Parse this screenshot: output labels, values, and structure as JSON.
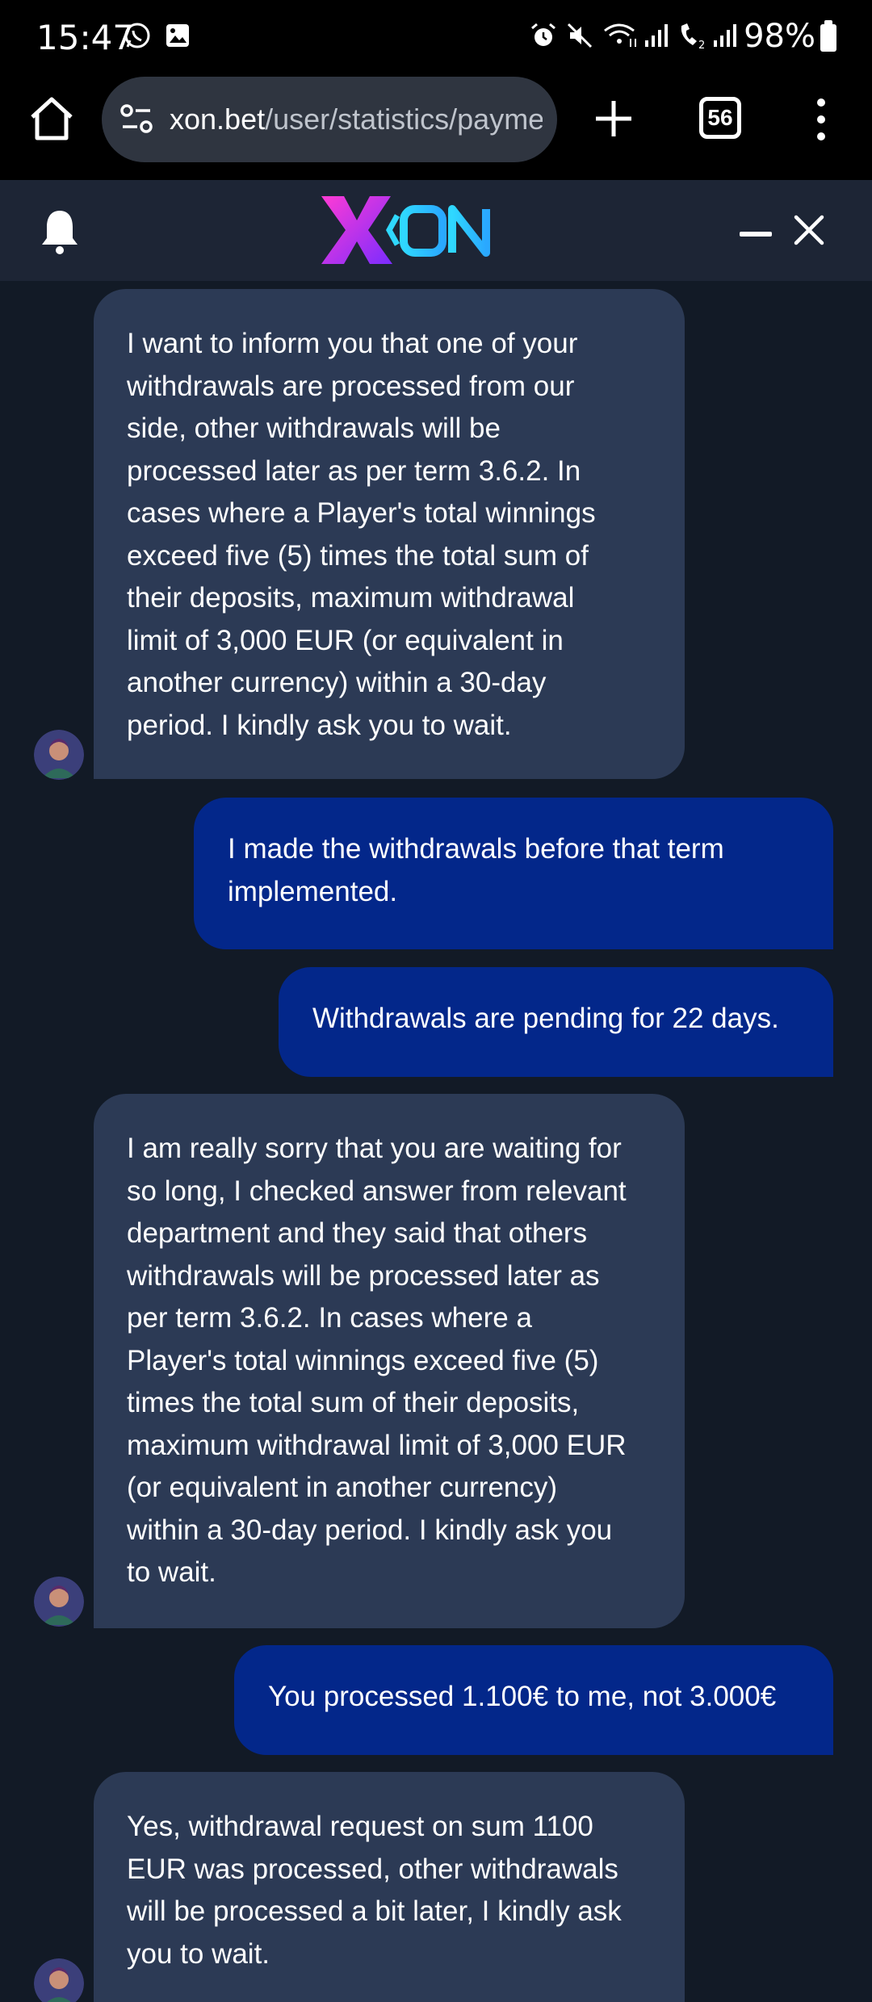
{
  "status_bar": {
    "time": "15:47",
    "battery": "98%",
    "icons": [
      "whatsapp-icon",
      "gallery-icon",
      "alarm-icon",
      "mute-icon",
      "wifi-icon",
      "signal-icon",
      "wifi-call-icon",
      "signal-icon",
      "battery-icon"
    ]
  },
  "browser": {
    "url_domain": "xon.bet",
    "url_path": "/user/statistics/paymer",
    "tab_count": "56"
  },
  "chat": {
    "brand": "XON",
    "accent_colors": {
      "agent_bubble": "#2c3a55",
      "user_bubble": "#03278a",
      "background": "#121a26",
      "header": "#1d2535"
    },
    "messages": [
      {
        "sender": "agent",
        "lines": [
          "I want to inform you that one of your",
          "withdrawals are processed from our",
          "side, other withdrawals will be",
          "processed later as per term 3.6.2. In",
          "cases where a Player's total winnings",
          "exceed five (5) times the total sum of",
          "their deposits, maximum withdrawal",
          "limit of 3,000 EUR (or equivalent in",
          "another currency) within a 30-day",
          "period. I kindly ask you to wait."
        ]
      },
      {
        "sender": "user",
        "lines": [
          "I made the withdrawals before that term",
          "implemented."
        ]
      },
      {
        "sender": "user",
        "lines": [
          "Withdrawals are pending for 22 days."
        ]
      },
      {
        "sender": "agent",
        "lines": [
          "I am really sorry that you are waiting for",
          "so long, I checked answer from relevant",
          "department and they said that others",
          "withdrawals will be processed later as",
          "per term 3.6.2. In cases where a",
          "Player's total winnings exceed five (5)",
          "times the total sum of their deposits,",
          "maximum withdrawal limit of 3,000 EUR",
          "(or equivalent in another currency)",
          "within a 30-day period. I kindly ask you",
          "to wait."
        ]
      },
      {
        "sender": "user",
        "lines": [
          "You processed 1.100€ to me, not 3.000€"
        ]
      },
      {
        "sender": "agent",
        "lines": [
          "Yes, withdrawal request on sum 1100",
          "EUR was processed, other withdrawals",
          "will be processed a bit later, I kindly ask",
          "you to wait."
        ]
      }
    ]
  }
}
